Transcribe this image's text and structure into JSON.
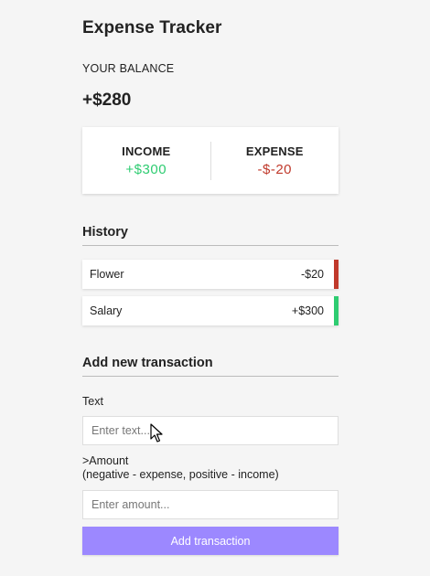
{
  "app": {
    "title": "Expense Tracker"
  },
  "balance": {
    "label": "YOUR BALANCE",
    "value": "+$280"
  },
  "summary": {
    "income_label": "INCOME",
    "income_value": "+$300",
    "expense_label": "EXPENSE",
    "expense_value": "-$-20"
  },
  "history": {
    "title": "History",
    "items": [
      {
        "text": "Flower",
        "amount": "-$20",
        "type": "minus"
      },
      {
        "text": "Salary",
        "amount": "+$300",
        "type": "plus"
      }
    ]
  },
  "form": {
    "title": "Add new transaction",
    "text_label": "Text",
    "text_placeholder": "Enter text...",
    "amount_label_line1": ">Amount",
    "amount_label_line2": "(negative - expense, positive - income)",
    "amount_placeholder": "Enter amount...",
    "submit_label": "Add transaction"
  },
  "colors": {
    "income": "#2ecc71",
    "expense": "#c0392b",
    "button": "#9c88ff"
  },
  "icons": {
    "cursor": "mouse-pointer-icon"
  }
}
